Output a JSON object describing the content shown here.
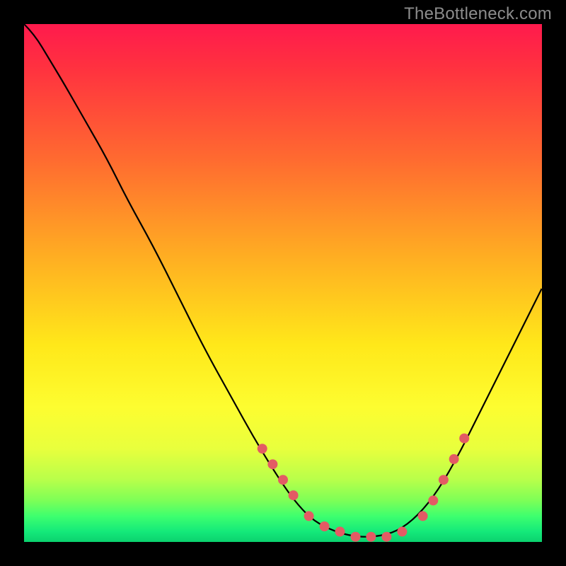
{
  "watermark": "TheBottleneck.com",
  "chart_data": {
    "type": "line",
    "title": "",
    "xlabel": "",
    "ylabel": "",
    "xlim": [
      0,
      100
    ],
    "ylim": [
      0,
      100
    ],
    "background": "gradient-red-yellow-green-vertical",
    "series": [
      {
        "name": "bottleneck-curve",
        "x": [
          0,
          2,
          5,
          8,
          12,
          16,
          20,
          25,
          30,
          35,
          40,
          45,
          50,
          53,
          56,
          60,
          64,
          68,
          72,
          76,
          80,
          84,
          88,
          92,
          96,
          100
        ],
        "y": [
          100,
          98,
          93,
          88,
          81,
          74,
          66,
          57,
          47,
          37,
          28,
          19,
          11,
          7,
          4,
          2,
          1,
          1,
          2,
          5,
          10,
          17,
          25,
          33,
          41,
          49
        ]
      }
    ],
    "marker_points": {
      "name": "dots",
      "x": [
        46,
        48,
        50,
        52,
        55,
        58,
        61,
        64,
        67,
        70,
        73,
        77,
        79,
        81,
        83,
        85
      ],
      "y": [
        18,
        15,
        12,
        9,
        5,
        3,
        2,
        1,
        1,
        1,
        2,
        5,
        8,
        12,
        16,
        20
      ]
    }
  }
}
